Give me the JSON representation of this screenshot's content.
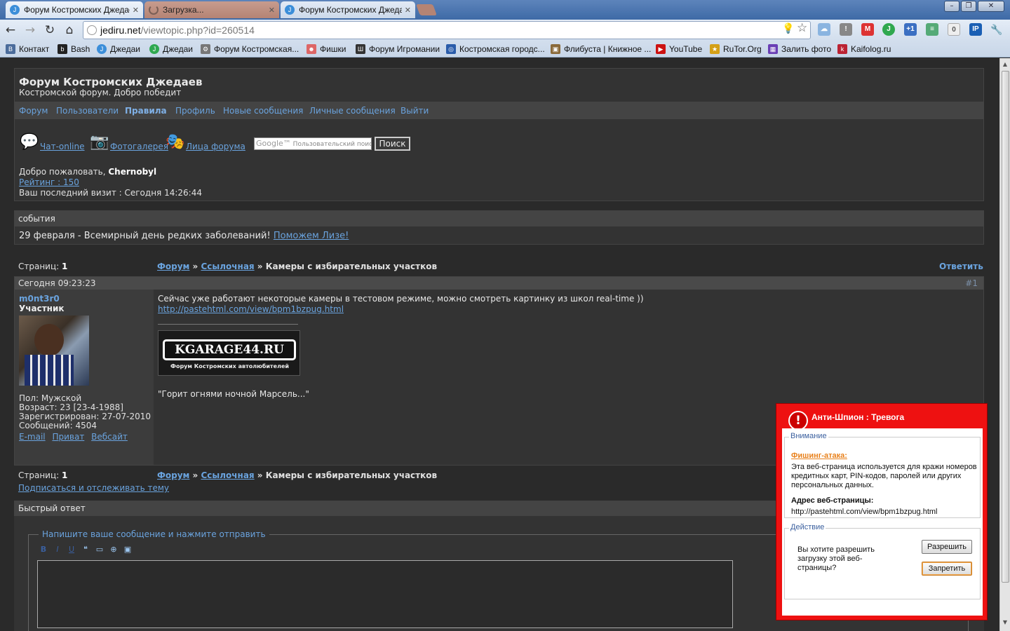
{
  "browser": {
    "tabs": [
      {
        "label": "Форум Костромских Джедаев"
      },
      {
        "label": "Загрузка..."
      },
      {
        "label": "Форум Костромских Джедаев"
      }
    ],
    "url_host": "jediru.net",
    "url_path": "/viewtopic.php?id=260514",
    "bookmarks": [
      {
        "label": "Контакт",
        "color": "#4b6c9b",
        "glyph": "B"
      },
      {
        "label": "Bash",
        "color": "#222222",
        "glyph": "b"
      },
      {
        "label": "Джедаи",
        "color": "#3b8ed9",
        "glyph": "J"
      },
      {
        "label": "Джедаи",
        "color": "#2fa84f",
        "glyph": "J"
      },
      {
        "label": "Форум Костромская...",
        "color": "#777777",
        "glyph": "⚙"
      },
      {
        "label": "Фишки",
        "color": "#d66",
        "glyph": "☻"
      },
      {
        "label": "Форум Игромании",
        "color": "#333333",
        "glyph": "Ш"
      },
      {
        "label": "Костромская городс...",
        "color": "#2a5caa",
        "glyph": "◎"
      },
      {
        "label": "Флибуста | Книжное ...",
        "color": "#8a6a3a",
        "glyph": "▣"
      },
      {
        "label": "YouTube",
        "color": "#cc1111",
        "glyph": "▶"
      },
      {
        "label": "RuTor.Org",
        "color": "#d4a017",
        "glyph": "★"
      },
      {
        "label": "Залить фото",
        "color": "#6a3fb5",
        "glyph": "▦"
      },
      {
        "label": "Kaifolog.ru",
        "color": "#b23",
        "glyph": "k"
      }
    ]
  },
  "site": {
    "title": "Форум Костромских Джедаев",
    "description": "Костромской форум. Добро победит",
    "nav": [
      "Форум",
      "Пользователи",
      "Правила",
      "Профиль",
      "Новые сообщения",
      "Личные сообщения",
      "Выйти"
    ],
    "quicklinks": [
      "Чат-online",
      "Фотогалерея",
      "Лица форума"
    ],
    "search_placeholder": "Пользовательский поис",
    "search_google": "Google™",
    "search_button": "Поиск",
    "welcome_prefix": "Добро пожаловать, ",
    "welcome_user": "Chernobyl",
    "rating": "Рейтинг : 150",
    "last_visit": "Ваш последний визит : Сегодня 14:26:44"
  },
  "events": {
    "header": "события",
    "text": "29 февраля - Всемирный день редких заболеваний! ",
    "link": "Поможем Лизе!"
  },
  "topic": {
    "pages_label": "Страниц: ",
    "pages_value": "1",
    "crumb_forum": "Форум",
    "crumb_section": "Ссылочная",
    "crumb_sep": " » ",
    "crumb_topic": "Камеры с избирательных участков",
    "reply": "Ответить",
    "subscribe": "Подписаться и отслеживать тему"
  },
  "post": {
    "time": "Сегодня 09:23:23",
    "number": "#1",
    "author": "m0nt3r0",
    "author_title": "Участник",
    "gender": "Пол: Мужской",
    "age": "Возраст: 23 [23-4-1988]",
    "registered": "Зарегистрирован: 27-07-2010",
    "messages": "Сообщений: 4504",
    "links": [
      "E-mail",
      "Приват",
      "Вебсайт"
    ],
    "text": "Сейчас уже работают некоторые камеры в тестовом режиме, можно смотреть картинку из школ real-time ))",
    "url": "http://pastehtml.com/view/bpm1bzpug.html",
    "banner_title": "KGARAGE44.RU",
    "banner_subtitle": "Форум Костромских автолюбителей",
    "signature": "\"Горит огнями ночной Марсель...\""
  },
  "quick_reply": {
    "header": "Быстрый ответ",
    "legend": "Напишите ваше сообщение и нажмите отправить"
  },
  "alert": {
    "title": "Анти-Шпион : Тревога",
    "attention_legend": "Внимание",
    "phishing_label": "Фишинг-атака:",
    "phishing_text": "Эта веб-страница используется для кражи номеров кредитных карт, PIN-кодов, паролей или других персональных данных.",
    "address_label": "Адрес веб-страницы:",
    "address_value": "http://pastehtml.com/view/bpm1bzpug.html",
    "action_legend": "Действие",
    "question": "Вы хотите разрешить загрузку этой веб-страницы?",
    "allow_button": "Разрешить",
    "deny_button": "Запретить"
  }
}
